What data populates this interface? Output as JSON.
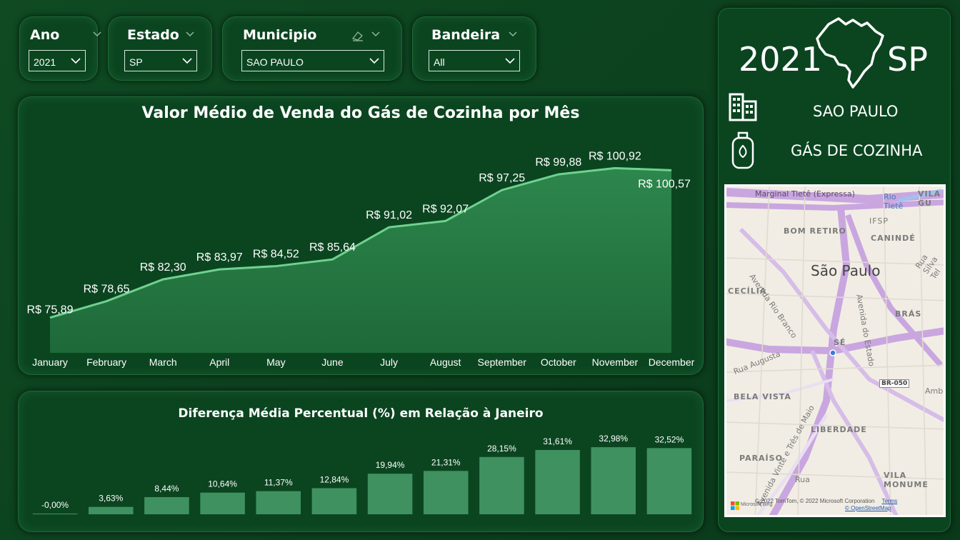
{
  "filters": [
    {
      "title": "Ano",
      "value": "2021"
    },
    {
      "title": "Estado",
      "value": "SP"
    },
    {
      "title": "Municipio",
      "value": "SAO PAULO"
    },
    {
      "title": "Bandeira",
      "value": "All"
    }
  ],
  "summary": {
    "year": "2021",
    "state": "SP",
    "city": "SAO PAULO",
    "product": "GÁS DE COZINHA"
  },
  "colors": {
    "background": "#0b4520",
    "area": "#2f8a4f",
    "line": "#6fd28f",
    "bar": "#3f9160"
  },
  "chart_data": [
    {
      "type": "area",
      "title": "Valor Médio de Venda do Gás de Cozinha por Mês",
      "categories": [
        "January",
        "February",
        "March",
        "April",
        "May",
        "June",
        "July",
        "August",
        "September",
        "October",
        "November",
        "December"
      ],
      "values": [
        75.89,
        78.65,
        82.3,
        83.97,
        84.52,
        85.64,
        91.02,
        92.07,
        97.25,
        99.88,
        100.92,
        100.57
      ],
      "labels": [
        "R$ 75,89",
        "R$ 78,65",
        "R$ 82,30",
        "R$ 83,97",
        "R$ 84,52",
        "R$ 85,64",
        "R$ 91,02",
        "R$ 92,07",
        "R$ 97,25",
        "R$ 99,88",
        "R$ 100,92",
        "R$ 100,57"
      ],
      "ylim": [
        70,
        103
      ],
      "grid": false
    },
    {
      "type": "bar",
      "title": "Diferença Média Percentual (%) em Relação à Janeiro",
      "categories": [
        "January",
        "February",
        "March",
        "April",
        "May",
        "June",
        "July",
        "August",
        "September",
        "October",
        "November",
        "December"
      ],
      "values": [
        0.0,
        3.63,
        8.44,
        10.64,
        11.37,
        12.84,
        19.94,
        21.31,
        28.15,
        31.61,
        32.98,
        32.52
      ],
      "labels": [
        "-0,00%",
        "3,63%",
        "8,44%",
        "10,64%",
        "11,37%",
        "12,84%",
        "19,94%",
        "21,31%",
        "28,15%",
        "31,61%",
        "32,98%",
        "32,52%"
      ],
      "ylim": [
        0,
        33
      ],
      "grid": false
    }
  ],
  "map": {
    "city_label": "São Paulo",
    "districts": [
      "BOM RETIRO",
      "CANINDÉ",
      "CECÍLIA",
      "BRÁS",
      "SÉ",
      "BELA VISTA",
      "LIBERDADE",
      "PARAÍSO",
      "VILA MONUME",
      "VILA GU",
      "IFSP",
      "Ambev"
    ],
    "streets": [
      "Marginal Tietê (Expressa)",
      "Rio Tietê",
      "Avenida Rio Branco",
      "Avenida do Estado",
      "Rua Augusta",
      "Avenida Vinte e Três de Maio",
      "Rua Silva Tel",
      "BR-050",
      "Rua"
    ],
    "attribution": "© 2022 TomTom, © 2022 Microsoft Corporation",
    "terms": "Terms",
    "osm": "© OpenStreetMap",
    "bing": "Microsoft Bing"
  }
}
